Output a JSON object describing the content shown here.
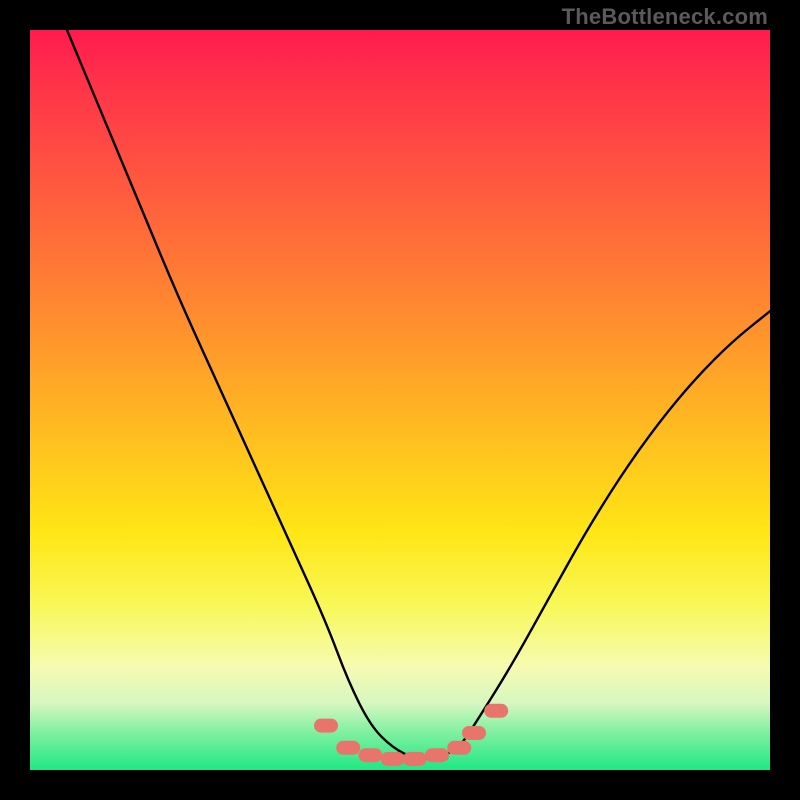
{
  "watermark": "TheBottleneck.com",
  "chart_data": {
    "type": "line",
    "title": "",
    "xlabel": "",
    "ylabel": "",
    "xlim": [
      0,
      100
    ],
    "ylim": [
      0,
      100
    ],
    "grid": false,
    "legend": false,
    "series": [
      {
        "name": "bottleneck-curve",
        "x": [
          5,
          10,
          15,
          20,
          25,
          30,
          35,
          40,
          43,
          46,
          49,
          52,
          55,
          58,
          60,
          65,
          70,
          75,
          80,
          85,
          90,
          95,
          100
        ],
        "y": [
          100,
          88,
          76,
          64,
          53,
          42,
          31,
          20,
          12,
          6,
          3,
          1.5,
          1.5,
          3,
          6,
          14,
          23,
          32,
          40,
          47,
          53,
          58,
          62
        ],
        "color": "#000000"
      },
      {
        "name": "bottom-marker-band",
        "type": "marker",
        "x": [
          40,
          43,
          46,
          49,
          52,
          55,
          58,
          60,
          63
        ],
        "y": [
          6,
          3,
          2,
          1.5,
          1.5,
          2,
          3,
          5,
          8
        ],
        "color": "#e9746b"
      }
    ],
    "background_gradient": {
      "orientation": "vertical",
      "stops": [
        {
          "pct": 0,
          "color": "#ff1a4f"
        },
        {
          "pct": 38,
          "color": "#ff8a30"
        },
        {
          "pct": 68,
          "color": "#ffe615"
        },
        {
          "pct": 86,
          "color": "#f6fbb0"
        },
        {
          "pct": 100,
          "color": "#1ee884"
        }
      ]
    }
  }
}
